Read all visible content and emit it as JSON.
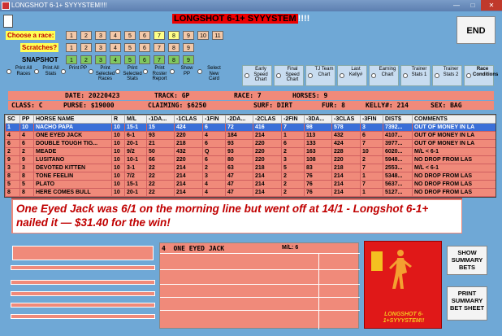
{
  "window": {
    "title": "LONGSHOT 6-1+ SYYYSTEM!!!!",
    "min": "—",
    "max": "□",
    "close": "✕"
  },
  "header": {
    "brand": "LONGSHOT 6-1+ SYYYSTEM",
    "suffix": "!!!!"
  },
  "race_row": {
    "label": "Choose  a race:",
    "buttons": [
      "1",
      "2",
      "3",
      "4",
      "5",
      "6",
      "7",
      "8",
      "9",
      "10",
      "11"
    ]
  },
  "scratch_row": {
    "label": "Scratches?",
    "buttons": [
      "1",
      "2",
      "3",
      "4",
      "5",
      "6",
      "7",
      "8",
      "9"
    ]
  },
  "snapshot_row": {
    "label": "SNAPSHOT",
    "buttons": [
      "1",
      "2",
      "3",
      "4",
      "5",
      "6",
      "7",
      "8",
      "9"
    ]
  },
  "end_label": "END",
  "options": [
    {
      "label": "Print All Races"
    },
    {
      "label": "Print All Stats"
    },
    {
      "label": "Print PP"
    },
    {
      "label": "Print Selected Races"
    },
    {
      "label": "Print Selected Stats"
    },
    {
      "label": "Print Roster Report"
    },
    {
      "label": "Show PP"
    },
    {
      "label": "Select New Card"
    }
  ],
  "option_boxes": [
    {
      "label": "Early Speed Chart"
    },
    {
      "label": "Final Speed Chart"
    },
    {
      "label": "TJ Team Chart"
    },
    {
      "label": "Last Kelly#"
    },
    {
      "label": "Earning Chart"
    },
    {
      "label": "Trainer Stats 1"
    },
    {
      "label": "Trainer Stats 2"
    },
    {
      "label": "Race Conditions"
    }
  ],
  "info1": {
    "date": "DATE: 20220423",
    "track": "TRACK: GP",
    "race": "RACE: 7",
    "horses": "HORSES: 9"
  },
  "info2": {
    "class": "CLASS: C",
    "purse": "PURSE: $19000",
    "claiming": "CLAIMING: $6250",
    "surf": "SURF: DIRT",
    "fur": "FUR: 8",
    "kelly": "KELLY#: 214",
    "sex": "SEX: BAG"
  },
  "table": {
    "headers": [
      "SC",
      "PP",
      "HORSE NAME",
      "R",
      "M/L",
      "-1DA...",
      "-1CLAS",
      "-1FIN",
      "-2DA...",
      "-2CLAS",
      "-2FIN",
      "-3DA...",
      "-3CLAS",
      "-3FIN",
      "DIST$",
      "COMMENTS"
    ],
    "rows": [
      [
        "1",
        "10",
        "NACHO PAPA",
        "10",
        "15-1",
        "15",
        "424",
        "6",
        "72",
        "416",
        "7",
        "98",
        "578",
        "3",
        "7392...",
        "OUT OF MONEY IN LA"
      ],
      [
        "4",
        "4",
        "ONE EYED JACK",
        "10",
        "6-1",
        "93",
        "220",
        "4",
        "184",
        "214",
        "1",
        "113",
        "432",
        "6",
        "4107...",
        "OUT OF MONEY IN LA"
      ],
      [
        "6",
        "6",
        "DOUBLE TOUGH TIG...",
        "10",
        "20-1",
        "21",
        "218",
        "6",
        "93",
        "220",
        "6",
        "133",
        "424",
        "7",
        "3977...",
        "OUT OF MONEY IN LA"
      ],
      [
        "2",
        "2",
        "MEADE",
        "10",
        "9/2",
        "50",
        "432",
        "Q",
        "93",
        "220",
        "2",
        "163",
        "228",
        "10",
        "6020...",
        "M/L < 6-1"
      ],
      [
        "9",
        "9",
        "LUSITANO",
        "10",
        "10-1",
        "66",
        "220",
        "6",
        "80",
        "220",
        "3",
        "108",
        "220",
        "2",
        "5948...",
        "NO DROP FROM LAS"
      ],
      [
        "3",
        "3",
        "DEVOTED KITTEN",
        "10",
        "3-1",
        "22",
        "214",
        "2",
        "63",
        "218",
        "5",
        "83",
        "218",
        "7",
        "2553...",
        "M/L < 6-1"
      ],
      [
        "8",
        "8",
        "TONE FEELIN",
        "10",
        "7/2",
        "22",
        "214",
        "3",
        "47",
        "214",
        "2",
        "76",
        "214",
        "1",
        "5348...",
        "NO DROP FROM LAS"
      ],
      [
        "5",
        "5",
        "PLATO",
        "10",
        "15-1",
        "22",
        "214",
        "4",
        "47",
        "214",
        "2",
        "76",
        "214",
        "7",
        "5637...",
        "NO DROP FROM LAS"
      ],
      [
        "8",
        "8",
        "HERE COMES BULL",
        "10",
        "20-1",
        "22",
        "214",
        "4",
        "47",
        "214",
        "2",
        "76",
        "214",
        "1",
        "5127...",
        "NO DROP FROM LAS"
      ]
    ]
  },
  "overlay_message": "One Eyed Jack was 6/1 on the morning line but went off at 14/1 - Longshot 6-1+ nailed it — $31.40 for the win!",
  "selected": {
    "pp": "4",
    "name": "ONE EYED JACK",
    "ml": "M/L: 6"
  },
  "logo_text": "LONGSHOT 6-1+SYYYSTEM!!",
  "buttons": {
    "summary": "SHOW SUMMARY BETS",
    "print": "PRINT SUMMARY BET SHEET"
  },
  "colors": {
    "row_bg": "#f08a7a",
    "selected_row": "#3a6fd8",
    "window_bg": "#6fa8d6",
    "logo_bg": "#e01818",
    "overlay_text": "#c00000"
  }
}
